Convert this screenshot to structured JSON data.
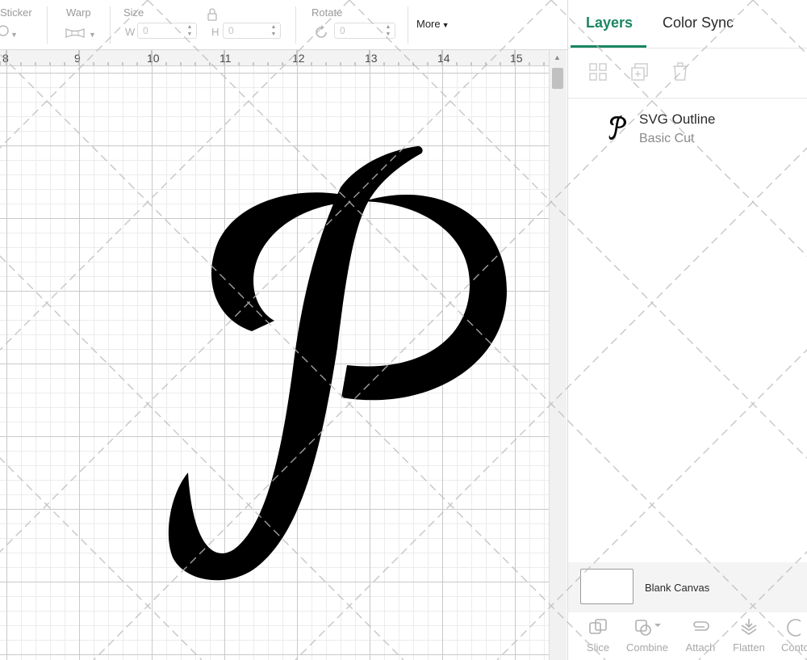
{
  "toolbar": {
    "sticker_label": "Sticker",
    "warp_label": "Warp",
    "size_label": "Size",
    "width_prefix": "W",
    "width_value": "0",
    "height_prefix": "H",
    "height_value": "0",
    "rotate_label": "Rotate",
    "rotate_value": "0",
    "more_label": "More"
  },
  "ruler": {
    "numbers": [
      "8",
      "9",
      "10",
      "11",
      "12",
      "13",
      "14",
      "15"
    ]
  },
  "canvas": {
    "letter": "P",
    "letter_color": "#000000"
  },
  "panel": {
    "tabs": [
      {
        "label": "Layers",
        "active": true
      },
      {
        "label": "Color Sync",
        "active": false
      }
    ],
    "layer": {
      "name": "SVG Outline",
      "operation": "Basic Cut"
    },
    "blank_canvas_label": "Blank Canvas",
    "tools": [
      {
        "label": "Slice",
        "icon": "slice-icon"
      },
      {
        "label": "Combine",
        "icon": "combine-icon"
      },
      {
        "label": "Attach",
        "icon": "attach-icon"
      },
      {
        "label": "Flatten",
        "icon": "flatten-icon"
      },
      {
        "label": "Contour",
        "icon": "contour-icon"
      }
    ]
  },
  "colors": {
    "accent": "#1a8760"
  }
}
